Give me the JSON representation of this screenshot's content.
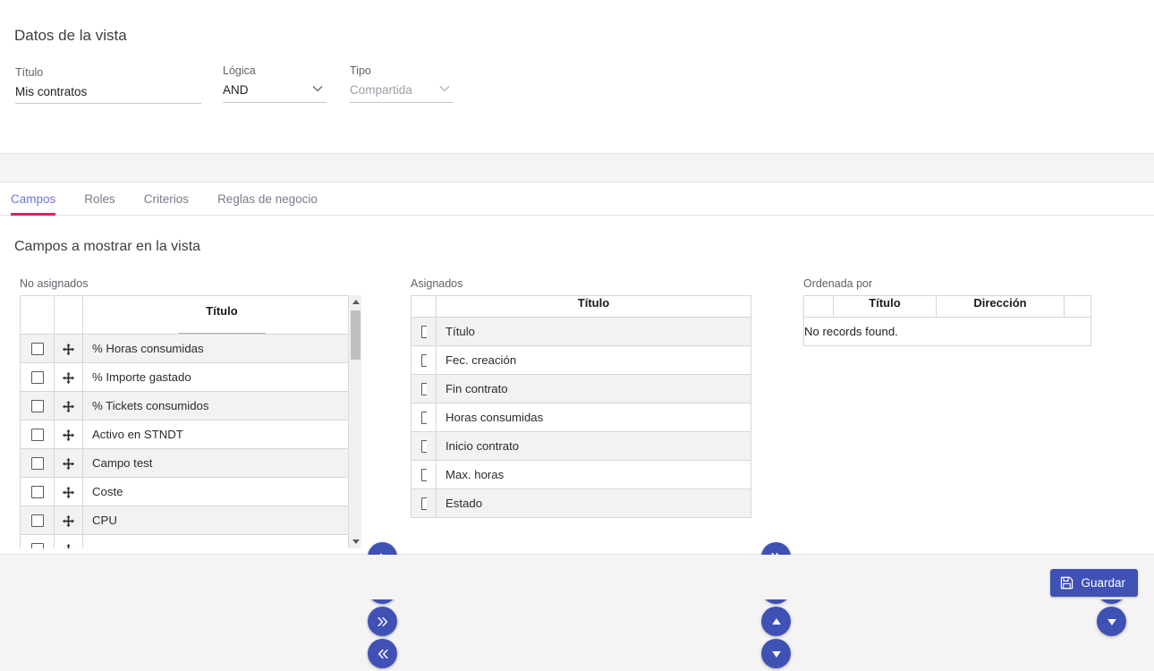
{
  "colors": {
    "accent_blue": "#3f51b5",
    "tab_active_text": "#6f74d8",
    "tab_underline": "#e0215c",
    "page_background": "#f4f4f4",
    "row_stripe": "#f2f2f2"
  },
  "top_card": {
    "section_title": "Datos de la vista",
    "fields": {
      "titulo": {
        "label": "Título",
        "value": "Mis contratos",
        "placeholder": ""
      },
      "logica": {
        "label": "Lógica",
        "value": "AND",
        "disabled": false
      },
      "tipo": {
        "label": "Tipo",
        "value": "Compartida",
        "disabled": true
      }
    }
  },
  "tabs": [
    {
      "label": "Campos",
      "active": true
    },
    {
      "label": "Roles",
      "active": false
    },
    {
      "label": "Criterios",
      "active": false
    },
    {
      "label": "Reglas de negocio",
      "active": false
    }
  ],
  "panel": {
    "heading": "Campos a mostrar en la vista"
  },
  "unassigned": {
    "label": "No asignados",
    "column_header": "Título",
    "filter_value": "",
    "rows": [
      {
        "title": "% Horas consumidas",
        "checked": false
      },
      {
        "title": "% Importe gastado",
        "checked": false
      },
      {
        "title": "% Tickets consumidos",
        "checked": false
      },
      {
        "title": "Activo en STNDT",
        "checked": false
      },
      {
        "title": "Campo test",
        "checked": false
      },
      {
        "title": "Coste",
        "checked": false
      },
      {
        "title": "CPU",
        "checked": false
      },
      {
        "title": "",
        "checked": false
      }
    ]
  },
  "assigned": {
    "label": "Asignados",
    "column_header": "Título",
    "rows": [
      {
        "title": "Título",
        "checked": false
      },
      {
        "title": "Fec. creación",
        "checked": false
      },
      {
        "title": "Fin contrato",
        "checked": false
      },
      {
        "title": "Horas consumidas",
        "checked": false
      },
      {
        "title": "Inicio contrato",
        "checked": false
      },
      {
        "title": "Max. horas",
        "checked": false
      },
      {
        "title": "Estado",
        "checked": false
      }
    ]
  },
  "ordered": {
    "label": "Ordenada por",
    "column_headers": [
      "",
      "Título",
      "Dirección",
      ""
    ],
    "empty_message": "No records found."
  },
  "transfer_buttons_left": [
    {
      "icon": "triangle-right-icon",
      "name": "move-right-button"
    },
    {
      "icon": "triangle-left-icon",
      "name": "move-left-button"
    },
    {
      "icon": "chevron-double-right-icon",
      "name": "move-all-right-button"
    },
    {
      "icon": "chevron-double-left-icon",
      "name": "move-all-left-button"
    }
  ],
  "transfer_buttons_middle": [
    {
      "icon": "chevron-double-right-icon",
      "name": "order-all-right-button"
    },
    {
      "icon": "triangle-right-icon",
      "name": "order-right-button"
    },
    {
      "icon": "triangle-up-icon",
      "name": "order-up-button"
    },
    {
      "icon": "triangle-down-icon",
      "name": "order-down-button"
    }
  ],
  "order_buttons_right": [
    {
      "icon": "triangle-up-icon",
      "name": "sort-up-button"
    },
    {
      "icon": "triangle-down-icon",
      "name": "sort-down-button"
    }
  ],
  "footer": {
    "save_label": "Guardar",
    "save_icon": "floppy-disk-icon"
  }
}
